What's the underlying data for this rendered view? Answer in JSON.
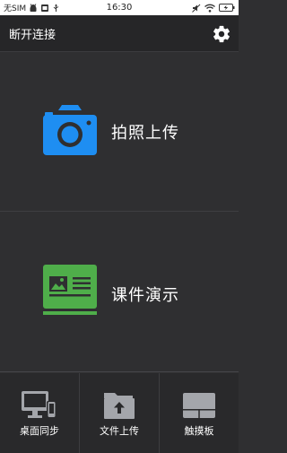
{
  "status_bar": {
    "carrier": "无SIM",
    "time": "16:30"
  },
  "header": {
    "disconnect_label": "断开连接"
  },
  "actions": {
    "photo_upload_label": "拍照上传",
    "slideshow_label": "课件演示"
  },
  "bottom_nav": {
    "desktop_sync_label": "桌面同步",
    "file_upload_label": "文件上传",
    "touchpad_label": "触摸板"
  },
  "colors": {
    "camera_blue": "#1e8ef2",
    "slides_green": "#4fae4a",
    "nav_icon_gray": "#a4a6ab"
  }
}
